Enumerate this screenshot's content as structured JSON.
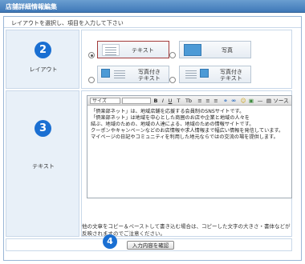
{
  "header": {
    "title": "店舗詳細情報編集"
  },
  "instruction": "レイアウトを選択し、項目を入力して下さい",
  "layout_row": {
    "number": "2",
    "label": "レイアウト",
    "options": [
      {
        "caption": "テキスト",
        "selected": true
      },
      {
        "caption": "写真",
        "selected": false
      },
      {
        "caption_line1": "写真付き",
        "caption_line2": "テキスト",
        "selected": false
      },
      {
        "caption_line1": "写真付き",
        "caption_line2": "テキスト",
        "selected": false
      }
    ]
  },
  "text_row": {
    "number": "3",
    "label": "テキスト",
    "toolbar": {
      "size_select": "サイズ",
      "bold": "B",
      "italic": "I",
      "underline": "U",
      "text_color": "T",
      "bg_color": "Tb",
      "source": "ソース"
    },
    "body_lines": [
      "「倶楽部ネット」は、地域店舗を応援する会員制のSNSサイトです。",
      "「倶楽部ネット」は地域を中心とした商圏のお店や企業と地域の人々を",
      "結ぶ、地域のための、地域の人達による、地域のための情報サイトです。",
      "クーポンやキャンペーンなどのお店情報や求人情報まで幅広い情報を発信しています。",
      "マイページの日記やコミュニティを利用した地元ならではの交流の場を提供します。"
    ]
  },
  "note": "他の文章をコピー＆ペーストして書き込む場合は、コピーした文字の大きさ・書体などが反映されますのでご注意ください。",
  "confirm": {
    "number": "4",
    "button_label": "入力内容を確認"
  },
  "colors": {
    "header": "#3f78b8",
    "number_circle": "#1a6fd2",
    "label_bg": "#e8f0f8",
    "selected_border": "#a23a3a"
  }
}
